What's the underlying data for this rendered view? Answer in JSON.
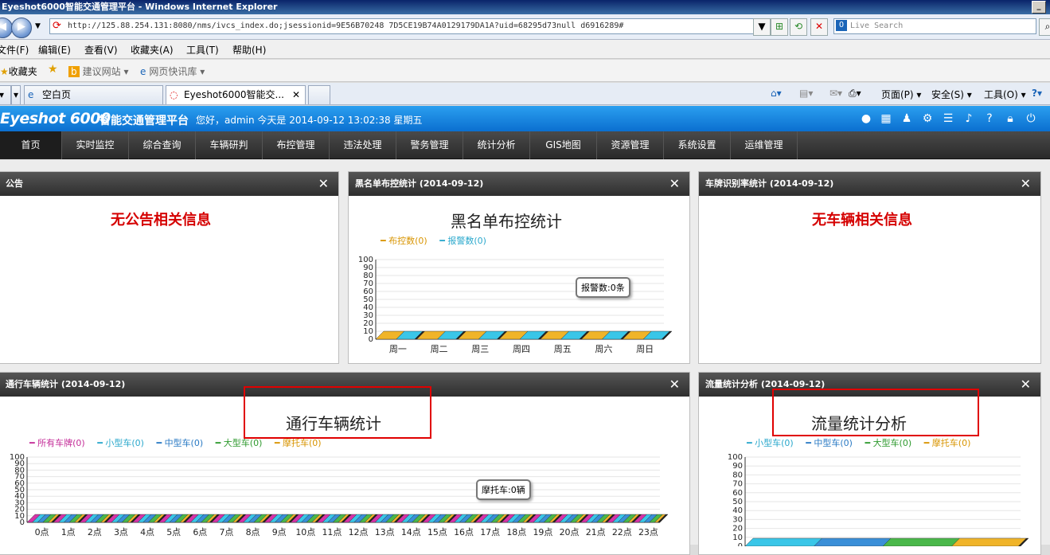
{
  "browser": {
    "window_title": "Eyeshot6000智能交通管理平台 - Windows Internet Explorer",
    "url": "http://125.88.254.131:8080/nms/ivcs_index.do;jsessionid=9E56B70248 7D5CE19B74A0129179DA1A?uid=68295d73null d6916289#",
    "search_placeholder": "Live Search",
    "menus": [
      "文件(F)",
      "编辑(E)",
      "查看(V)",
      "收藏夹(A)",
      "工具(T)",
      "帮助(H)"
    ],
    "favorites_label": "收藏夹",
    "fav_items": [
      "建议网站 ▾",
      "网页快讯库 ▾"
    ],
    "tabs": [
      "空白页",
      "Eyeshot6000智能交..."
    ],
    "toolbar_items": [
      "页面(P) ▾",
      "安全(S) ▾",
      "工具(O) ▾"
    ]
  },
  "app": {
    "logo": "Eyeshot 6000",
    "platform_name": "智能交通管理平台",
    "greeting": "您好，admin 今天是 2014-09-12 13:02:38 星期五",
    "nav": [
      "首页",
      "实时监控",
      "综合查询",
      "车辆研判",
      "布控管理",
      "违法处理",
      "警务管理",
      "统计分析",
      "GIS地图",
      "资源管理",
      "系统设置",
      "运维管理"
    ]
  },
  "panels": {
    "notice": {
      "title": "公告",
      "message": "无公告相关信息"
    },
    "blacklist": {
      "title": "黑名单布控统计 (2014-09-12)",
      "chart_title": "黑名单布控统计",
      "legend": [
        "布控数(0)",
        "报警数(0)"
      ],
      "tooltip": "报警数:0条"
    },
    "plate_rate": {
      "title": "车牌识别率统计 (2014-09-12)",
      "message": "无车辆相关信息"
    },
    "traffic": {
      "title": "通行车辆统计 (2014-09-12)",
      "chart_title": "通行车辆统计",
      "legend": [
        "所有车牌(0)",
        "小型车(0)",
        "中型车(0)",
        "大型车(0)",
        "摩托车(0)"
      ],
      "tooltip": "摩托车:0辆"
    },
    "flow": {
      "title": "流量统计分析 (2014-09-12)",
      "chart_title": "流量统计分析",
      "legend": [
        "小型车(0)",
        "中型车(0)",
        "大型车(0)",
        "摩托车(0)"
      ]
    }
  },
  "chart_data": [
    {
      "type": "bar",
      "title": "黑名单布控统计",
      "categories": [
        "周一",
        "周二",
        "周三",
        "周四",
        "周五",
        "周六",
        "周日"
      ],
      "series": [
        {
          "name": "布控数",
          "values": [
            0,
            0,
            0,
            0,
            0,
            0,
            0
          ],
          "color": "#f0b429"
        },
        {
          "name": "报警数",
          "values": [
            0,
            0,
            0,
            0,
            0,
            0,
            0
          ],
          "color": "#3ac6e8"
        }
      ],
      "ylim": [
        0,
        100
      ],
      "yticks": [
        0,
        10,
        20,
        30,
        40,
        50,
        60,
        70,
        80,
        90,
        100
      ],
      "grid": true,
      "legend": "top-left"
    },
    {
      "type": "bar",
      "title": "通行车辆统计",
      "categories": [
        "0点",
        "1点",
        "2点",
        "3点",
        "4点",
        "5点",
        "6点",
        "7点",
        "8点",
        "9点",
        "10点",
        "11点",
        "12点",
        "13点",
        "14点",
        "15点",
        "16点",
        "17点",
        "18点",
        "19点",
        "20点",
        "21点",
        "22点",
        "23点"
      ],
      "series": [
        {
          "name": "所有车牌",
          "values": [
            0,
            0,
            0,
            0,
            0,
            0,
            0,
            0,
            0,
            0,
            0,
            0,
            0,
            0,
            0,
            0,
            0,
            0,
            0,
            0,
            0,
            0,
            0,
            0
          ],
          "color": "#d633a8"
        },
        {
          "name": "小型车",
          "values": [
            0,
            0,
            0,
            0,
            0,
            0,
            0,
            0,
            0,
            0,
            0,
            0,
            0,
            0,
            0,
            0,
            0,
            0,
            0,
            0,
            0,
            0,
            0,
            0
          ],
          "color": "#3ac6e8"
        },
        {
          "name": "中型车",
          "values": [
            0,
            0,
            0,
            0,
            0,
            0,
            0,
            0,
            0,
            0,
            0,
            0,
            0,
            0,
            0,
            0,
            0,
            0,
            0,
            0,
            0,
            0,
            0,
            0
          ],
          "color": "#3a8fd8"
        },
        {
          "name": "大型车",
          "values": [
            0,
            0,
            0,
            0,
            0,
            0,
            0,
            0,
            0,
            0,
            0,
            0,
            0,
            0,
            0,
            0,
            0,
            0,
            0,
            0,
            0,
            0,
            0,
            0
          ],
          "color": "#4ab84a"
        },
        {
          "name": "摩托车",
          "values": [
            0,
            0,
            0,
            0,
            0,
            0,
            0,
            0,
            0,
            0,
            0,
            0,
            0,
            0,
            0,
            0,
            0,
            0,
            0,
            0,
            0,
            0,
            0,
            0
          ],
          "color": "#f0b429"
        }
      ],
      "ylim": [
        0,
        100
      ],
      "yticks": [
        0,
        10,
        20,
        30,
        40,
        50,
        60,
        70,
        80,
        90,
        100
      ],
      "grid": true,
      "legend": "top-left"
    },
    {
      "type": "bar",
      "title": "流量统计分析",
      "categories": [],
      "series": [
        {
          "name": "小型车",
          "values": [
            0
          ],
          "color": "#3ac6e8"
        },
        {
          "name": "中型车",
          "values": [
            0
          ],
          "color": "#3a8fd8"
        },
        {
          "name": "大型车",
          "values": [
            0
          ],
          "color": "#4ab84a"
        },
        {
          "name": "摩托车",
          "values": [
            0
          ],
          "color": "#f0b429"
        }
      ],
      "ylim": [
        0,
        100
      ],
      "yticks": [
        0,
        10,
        20,
        30,
        40,
        50,
        60,
        70,
        80,
        90,
        100
      ],
      "grid": true,
      "legend": "top-left"
    }
  ]
}
